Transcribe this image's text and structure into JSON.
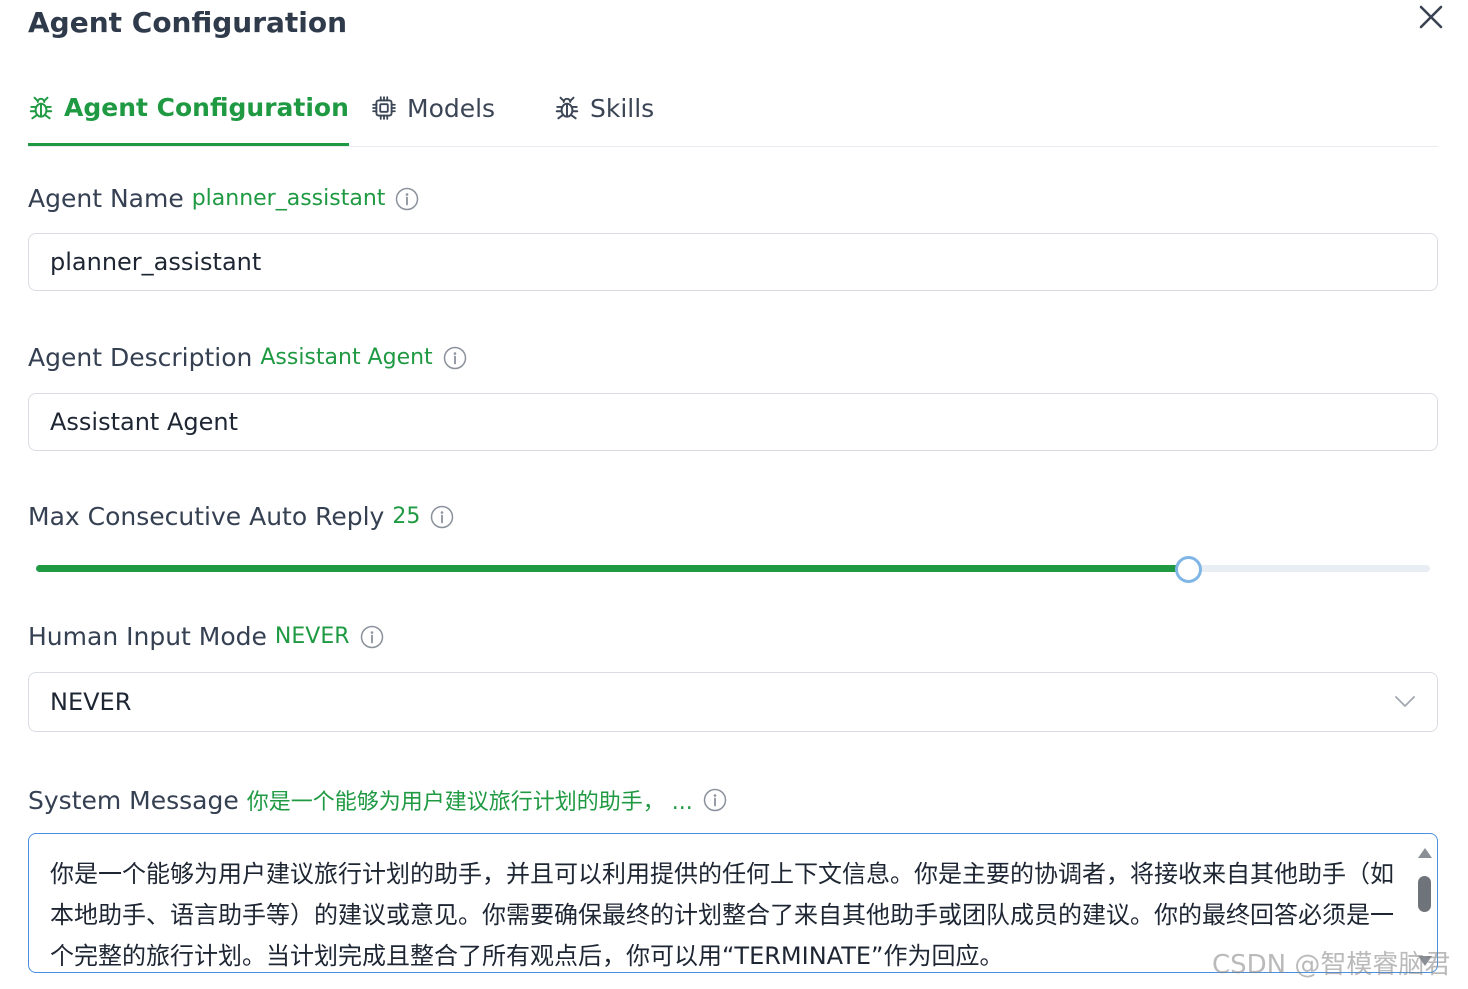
{
  "dialog": {
    "title": "Agent Configuration"
  },
  "tabs": [
    {
      "label": "Agent Configuration",
      "icon": "bug-icon",
      "active": true
    },
    {
      "label": "Models",
      "icon": "cpu-chip-icon",
      "active": false
    },
    {
      "label": "Skills",
      "icon": "bug-icon",
      "active": false
    }
  ],
  "fields": {
    "agent_name": {
      "label": "Agent Name",
      "current": "planner_assistant",
      "value": "planner_assistant"
    },
    "agent_description": {
      "label": "Agent Description",
      "current": "Assistant Agent",
      "value": "Assistant Agent"
    },
    "max_consecutive_auto_reply": {
      "label": "Max Consecutive Auto Reply",
      "current": "25",
      "fraction": 0.826
    },
    "human_input_mode": {
      "label": "Human Input Mode",
      "current": "NEVER",
      "value": "NEVER"
    },
    "system_message": {
      "label": "System Message",
      "current": "你是一个能够为用户建议旅行计划的助手，  ...",
      "value": "你是一个能够为用户建议旅行计划的助手，并且可以利用提供的任何上下文信息。你是主要的协调者，将接收来自其他助手（如本地助手、语言助手等）的建议或意见。你需要确保最终的计划整合了来自其他助手或团队成员的建议。你的最终回答必须是一个完整的旅行计划。当计划完成且整合了所有观点后，你可以用“TERMINATE”作为回应。"
    }
  },
  "watermark": "CSDN @智模睿脑君",
  "colors": {
    "accent": "#1f9a43",
    "focus_border": "#4a90e2",
    "slider_handle_border": "#7fb6e6"
  }
}
